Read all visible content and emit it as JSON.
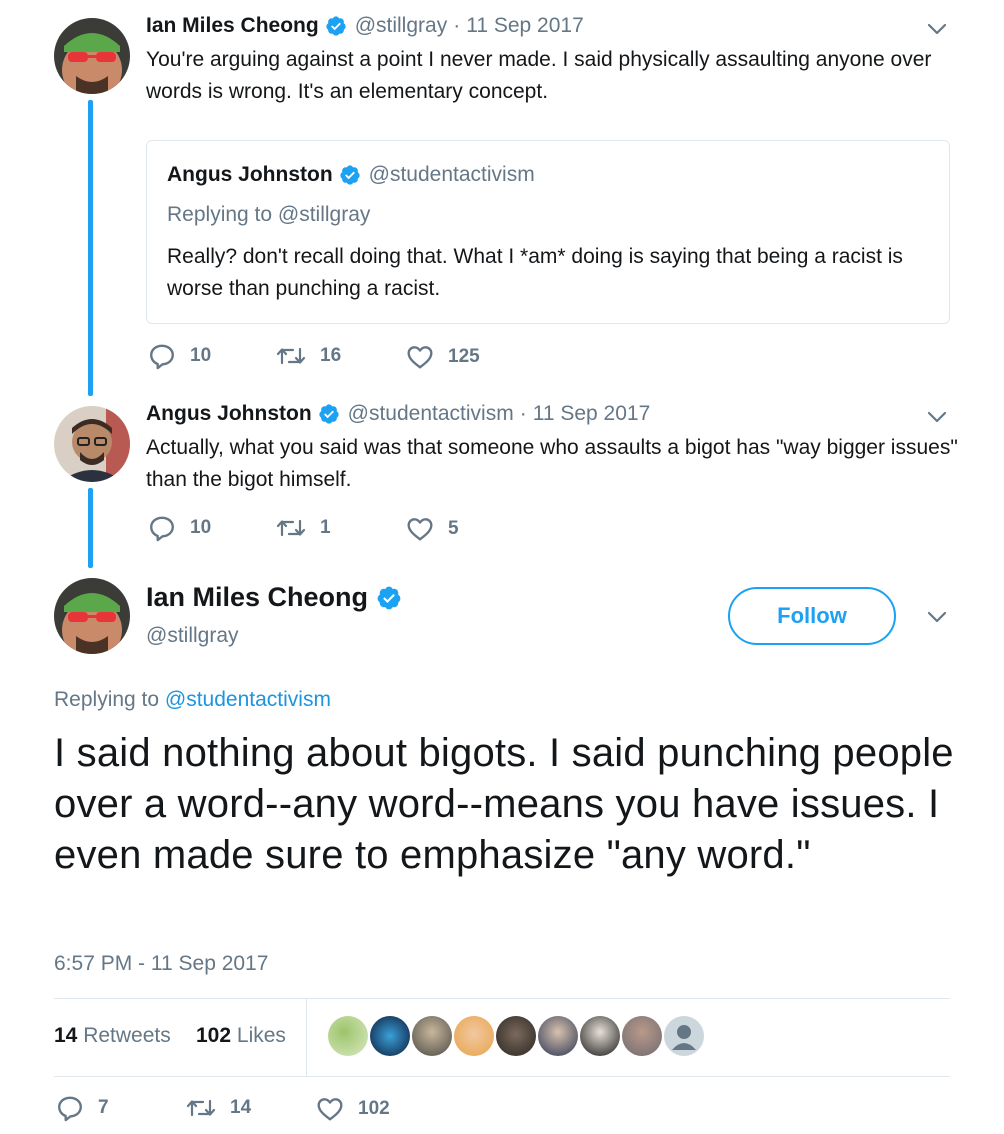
{
  "tweet1": {
    "name": "Ian Miles Cheong",
    "handle": "@stillgray",
    "separator": "·",
    "date": "11 Sep 2017",
    "text": "You're arguing against a point I never made. I said physically assaulting anyone over words is wrong. It's an elementary concept.",
    "quote": {
      "name": "Angus Johnston",
      "handle": "@studentactivism",
      "replying": "Replying to @stillgray",
      "text": "Really? don't recall doing that. What I *am* doing is saying that being a racist is worse than punching a racist."
    },
    "replies": "10",
    "retweets": "16",
    "likes": "125"
  },
  "tweet2": {
    "name": "Angus Johnston",
    "handle": "@studentactivism",
    "separator": "·",
    "date": "11 Sep 2017",
    "text": "Actually, what you said was that someone who assaults a bigot has \"way bigger issues\" than the bigot himself.",
    "replies": "10",
    "retweets": "1",
    "likes": "5"
  },
  "main": {
    "name": "Ian Miles Cheong",
    "handle": "@stillgray",
    "follow_label": "Follow",
    "replying_prefix": "Replying to ",
    "replying_to": "@studentactivism",
    "text": "I said nothing about bigots. I said punching people over a word--any word--means you have issues. I even made sure to emphasize \"any word.\"",
    "timestamp": "6:57 PM - 11 Sep 2017",
    "retweets_count": "14",
    "retweets_label": "Retweets",
    "likes_count": "102",
    "likes_label": "Likes",
    "replies": "7",
    "retweets": "14",
    "likes": "102"
  },
  "colors": {
    "accent": "#1da1f2",
    "text": "#14171a",
    "muted": "#657786",
    "border": "#e1e8ed"
  },
  "icons": {
    "verified": "verified-badge-icon",
    "reply": "reply-icon",
    "retweet": "retweet-icon",
    "like": "heart-icon",
    "caret": "chevron-down-icon"
  }
}
